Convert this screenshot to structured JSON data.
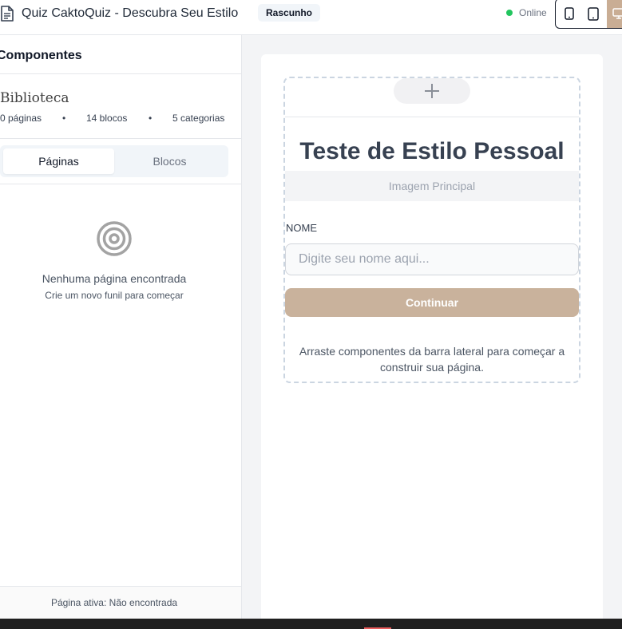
{
  "header": {
    "title": "Quiz CaktoQuiz - Descubra Seu Estilo",
    "status_badge": "Rascunho",
    "connection_status": "Online",
    "accent_color": "#c9ad94",
    "device_buttons": [
      "mobile-icon",
      "tablet-icon",
      "desktop-icon"
    ]
  },
  "sidebar": {
    "heading": "Componentes",
    "library": {
      "title": "Biblioteca",
      "pages_count": "0 páginas",
      "blocks_count": "14 blocos",
      "categories_count": "5 categorias",
      "separator": "•"
    },
    "tabs": [
      {
        "label": "Páginas",
        "active": true
      },
      {
        "label": "Blocos",
        "active": false
      }
    ],
    "empty_state": {
      "icon": "target-icon",
      "title": "Nenhuma página encontrada",
      "subtitle": "Crie um novo funil para começar"
    },
    "footer": "Página ativa: Não encontrada"
  },
  "canvas": {
    "add_icon": "plus-icon",
    "quiz_title": "Teste de Estilo Pessoal",
    "image_placeholder": "Imagem Principal",
    "name_label": "NOME",
    "name_placeholder": "Digite seu nome aqui...",
    "continue_button": "Continuar",
    "button_color": "#c9b29c",
    "hint": "Arraste componentes da barra lateral para começar a construir sua página."
  }
}
